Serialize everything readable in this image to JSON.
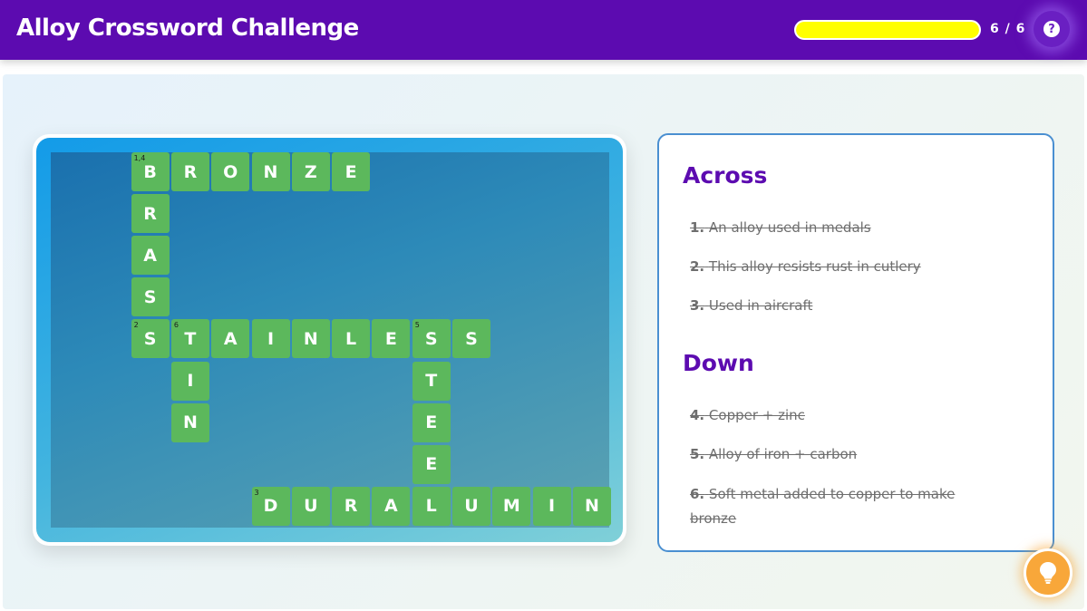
{
  "header": {
    "title": "Alloy Crossword Challenge",
    "progress_label": "6 / 6",
    "progress_fraction": 1.0,
    "help_label": "?",
    "accent_color": "#5c0bb0",
    "progress_color": "#ffff00"
  },
  "grid": {
    "cell_color": "#5cb85c",
    "cells": [
      {
        "row": 0,
        "col": 2,
        "letter": "B",
        "number": "1,4"
      },
      {
        "row": 0,
        "col": 3,
        "letter": "R",
        "number": ""
      },
      {
        "row": 0,
        "col": 4,
        "letter": "O",
        "number": ""
      },
      {
        "row": 0,
        "col": 5,
        "letter": "N",
        "number": ""
      },
      {
        "row": 0,
        "col": 6,
        "letter": "Z",
        "number": ""
      },
      {
        "row": 0,
        "col": 7,
        "letter": "E",
        "number": ""
      },
      {
        "row": 1,
        "col": 2,
        "letter": "R",
        "number": ""
      },
      {
        "row": 2,
        "col": 2,
        "letter": "A",
        "number": ""
      },
      {
        "row": 3,
        "col": 2,
        "letter": "S",
        "number": ""
      },
      {
        "row": 4,
        "col": 2,
        "letter": "S",
        "number": "2"
      },
      {
        "row": 4,
        "col": 3,
        "letter": "T",
        "number": "6"
      },
      {
        "row": 4,
        "col": 4,
        "letter": "A",
        "number": ""
      },
      {
        "row": 4,
        "col": 5,
        "letter": "I",
        "number": ""
      },
      {
        "row": 4,
        "col": 6,
        "letter": "N",
        "number": ""
      },
      {
        "row": 4,
        "col": 7,
        "letter": "L",
        "number": ""
      },
      {
        "row": 4,
        "col": 8,
        "letter": "E",
        "number": ""
      },
      {
        "row": 4,
        "col": 9,
        "letter": "S",
        "number": "5"
      },
      {
        "row": 4,
        "col": 10,
        "letter": "S",
        "number": ""
      },
      {
        "row": 5,
        "col": 3,
        "letter": "I",
        "number": ""
      },
      {
        "row": 5,
        "col": 9,
        "letter": "T",
        "number": ""
      },
      {
        "row": 6,
        "col": 3,
        "letter": "N",
        "number": ""
      },
      {
        "row": 6,
        "col": 9,
        "letter": "E",
        "number": ""
      },
      {
        "row": 7,
        "col": 9,
        "letter": "E",
        "number": ""
      },
      {
        "row": 8,
        "col": 5,
        "letter": "D",
        "number": "3"
      },
      {
        "row": 8,
        "col": 6,
        "letter": "U",
        "number": ""
      },
      {
        "row": 8,
        "col": 7,
        "letter": "R",
        "number": ""
      },
      {
        "row": 8,
        "col": 8,
        "letter": "A",
        "number": ""
      },
      {
        "row": 8,
        "col": 9,
        "letter": "L",
        "number": ""
      },
      {
        "row": 8,
        "col": 10,
        "letter": "U",
        "number": ""
      },
      {
        "row": 8,
        "col": 11,
        "letter": "M",
        "number": ""
      },
      {
        "row": 8,
        "col": 12,
        "letter": "I",
        "number": ""
      },
      {
        "row": 8,
        "col": 13,
        "letter": "N",
        "number": ""
      }
    ]
  },
  "clues": {
    "across_heading": "Across",
    "down_heading": "Down",
    "across": [
      {
        "num": "1.",
        "text": "An alloy used in medals",
        "solved": true
      },
      {
        "num": "2.",
        "text": "This alloy resists rust in cutlery",
        "solved": true
      },
      {
        "num": "3.",
        "text": "Used in aircraft",
        "solved": true
      }
    ],
    "down": [
      {
        "num": "4.",
        "text": "Copper + zinc",
        "solved": true
      },
      {
        "num": "5.",
        "text": "Alloy of iron + carbon",
        "solved": true
      },
      {
        "num": "6.",
        "text": "Soft metal added to copper to make bronze",
        "solved": true
      }
    ]
  },
  "hint": {
    "icon": "lightbulb-icon",
    "color": "#f8a73a"
  }
}
